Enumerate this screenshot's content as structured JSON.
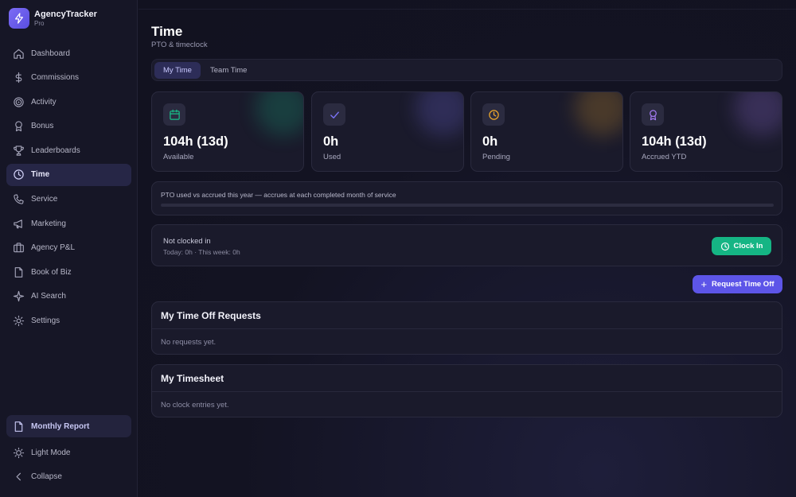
{
  "app": {
    "name": "AgencyTracker",
    "tier": "Pro"
  },
  "sidebar": {
    "items": [
      {
        "label": "Dashboard",
        "icon": "home-icon"
      },
      {
        "label": "Commissions",
        "icon": "dollar-icon"
      },
      {
        "label": "Activity",
        "icon": "target-icon"
      },
      {
        "label": "Bonus",
        "icon": "medal-icon"
      },
      {
        "label": "Leaderboards",
        "icon": "trophy-icon"
      },
      {
        "label": "Time",
        "icon": "clock-icon",
        "active": true
      },
      {
        "label": "Service",
        "icon": "phone-icon"
      },
      {
        "label": "Marketing",
        "icon": "megaphone-icon"
      },
      {
        "label": "Agency P&L",
        "icon": "briefcase-icon"
      },
      {
        "label": "Book of Biz",
        "icon": "document-icon"
      },
      {
        "label": "AI Search",
        "icon": "sparkle-icon"
      },
      {
        "label": "Settings",
        "icon": "gear-icon"
      }
    ],
    "monthly_report": "Monthly Report",
    "light_mode": "Light Mode",
    "collapse": "Collapse"
  },
  "page": {
    "title": "Time",
    "subtitle": "PTO & timeclock"
  },
  "tabs": [
    {
      "label": "My Time",
      "active": true
    },
    {
      "label": "Team Time",
      "active": false
    }
  ],
  "stats": [
    {
      "value": "104h (13d)",
      "label": "Available",
      "icon": "calendar-icon",
      "color": "#19c08a"
    },
    {
      "value": "0h",
      "label": "Used",
      "icon": "check-icon",
      "color": "#7b73f5"
    },
    {
      "value": "0h",
      "label": "Pending",
      "icon": "clock-icon",
      "color": "#f0a92a"
    },
    {
      "value": "104h (13d)",
      "label": "Accrued YTD",
      "icon": "award-icon",
      "color": "#a67cf5"
    }
  ],
  "pto": {
    "text": "PTO used vs accrued this year — accrues at each completed month of service",
    "used_fraction": 0
  },
  "clock": {
    "status": "Not clocked in",
    "summary": "Today: 0h · This week: 0h",
    "button": "Clock In"
  },
  "request_button": "Request Time Off",
  "time_off_requests": {
    "title": "My Time Off Requests",
    "empty": "No requests yet."
  },
  "timesheet": {
    "title": "My Timesheet",
    "empty": "No clock entries yet."
  },
  "colors": {
    "accent": "#5d55e8",
    "success": "#15b584",
    "background": "#121220"
  }
}
